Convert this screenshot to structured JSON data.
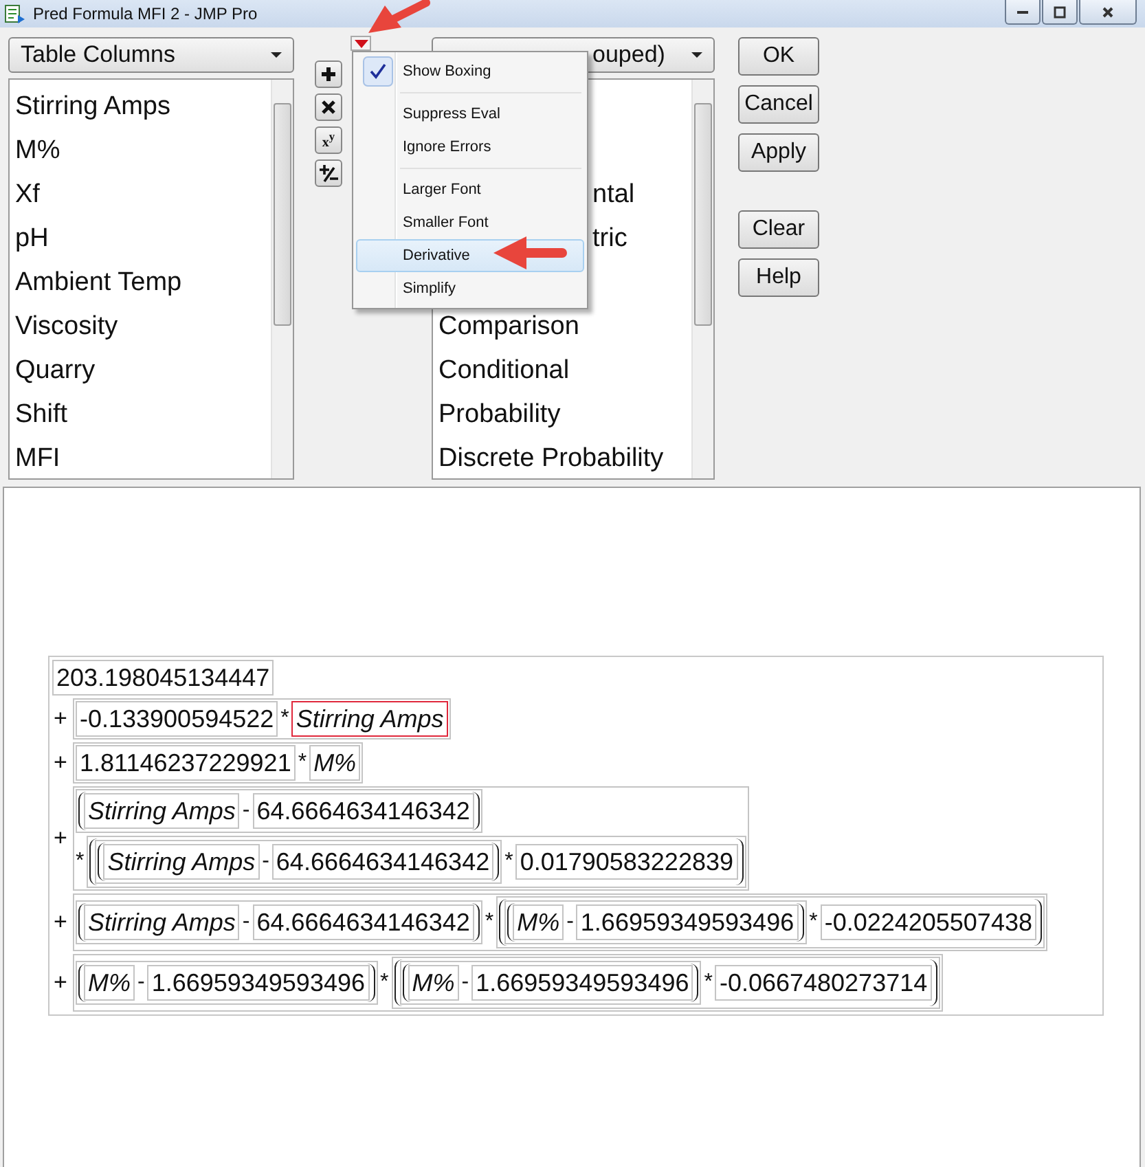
{
  "window": {
    "title": "Pred Formula MFI 2 - JMP Pro"
  },
  "columns_panel": {
    "dropdown": "Table Columns",
    "items": [
      "Stirring Amps",
      "M%",
      "Xf",
      "pH",
      "Ambient Temp",
      "Viscosity",
      "Quarry",
      "Shift",
      "MFI"
    ]
  },
  "keypad": [
    {
      "kind": "plus"
    },
    {
      "kind": "times"
    },
    {
      "kind": "power",
      "label": "x$^{y}$"
    },
    {
      "kind": "plusminus"
    }
  ],
  "options_menu": {
    "items": [
      {
        "kind": "item",
        "label": "Show Boxing",
        "checked": true,
        "selected": false
      },
      {
        "kind": "separator"
      },
      {
        "kind": "item",
        "label": "Suppress Eval",
        "checked": false,
        "selected": false
      },
      {
        "kind": "item",
        "label": "Ignore Errors",
        "checked": false,
        "selected": false
      },
      {
        "kind": "separator"
      },
      {
        "kind": "item",
        "label": "Larger Font",
        "checked": false,
        "selected": false
      },
      {
        "kind": "item",
        "label": "Smaller Font",
        "checked": false,
        "selected": false
      },
      {
        "kind": "item",
        "label": "Derivative",
        "checked": false,
        "selected": true
      },
      {
        "kind": "item",
        "label": "Simplify",
        "checked": false,
        "selected": false
      }
    ]
  },
  "functions_panel": {
    "dropdown": "ouped)",
    "items": [
      {
        "text": "ntal",
        "kind": "cut"
      },
      {
        "text": "tric",
        "kind": "cut"
      },
      {
        "text": "Comparison",
        "kind": "full"
      },
      {
        "text": "Conditional",
        "kind": "full"
      },
      {
        "text": "Probability",
        "kind": "full"
      },
      {
        "text": "Discrete Probability",
        "kind": "full"
      }
    ]
  },
  "buttons": [
    {
      "label": "OK",
      "kind": "push"
    },
    {
      "label": "Cancel",
      "kind": "push"
    },
    {
      "label": "Apply",
      "kind": "push"
    },
    {
      "label": "Clear",
      "kind": "gap"
    },
    {
      "label": "Help",
      "kind": "push"
    }
  ],
  "formula": {
    "terms": [
      {
        "items": [
          {
            "kind": "num",
            "text": "203.198045134447"
          }
        ]
      },
      {
        "sign": "+",
        "items": [
          {
            "kind": "group",
            "items": [
              {
                "kind": "num",
                "text": "-0.133900594522"
              },
              {
                "kind": "op",
                "text": "*"
              },
              {
                "kind": "col",
                "text": "Stirring Amps",
                "selected": true
              }
            ]
          }
        ]
      },
      {
        "sign": "+",
        "items": [
          {
            "kind": "group",
            "items": [
              {
                "kind": "num",
                "text": "1.81146237229921"
              },
              {
                "kind": "op",
                "text": "*"
              },
              {
                "kind": "col",
                "text": "M%",
                "selected": false
              }
            ]
          }
        ]
      },
      {
        "sign": "+",
        "items": [
          {
            "kind": "stack",
            "lines": [
              {
                "items": [
                  {
                    "kind": "paren",
                    "items": [
                      {
                        "kind": "col",
                        "text": "Stirring Amps",
                        "selected": false
                      },
                      {
                        "kind": "op",
                        "text": "-"
                      },
                      {
                        "kind": "num",
                        "text": "64.6664634146342"
                      }
                    ]
                  }
                ]
              },
              {
                "items": [
                  {
                    "kind": "op",
                    "text": "*"
                  },
                  {
                    "kind": "paren",
                    "items": [
                      {
                        "kind": "paren",
                        "items": [
                          {
                            "kind": "col",
                            "text": "Stirring Amps",
                            "selected": false
                          },
                          {
                            "kind": "op",
                            "text": "-"
                          },
                          {
                            "kind": "num",
                            "text": "64.6664634146342"
                          }
                        ]
                      },
                      {
                        "kind": "op",
                        "text": "*"
                      },
                      {
                        "kind": "num",
                        "text": "0.01790583222839"
                      }
                    ]
                  }
                ]
              }
            ]
          }
        ]
      },
      {
        "sign": "+",
        "items": [
          {
            "kind": "group",
            "items": [
              {
                "kind": "paren",
                "items": [
                  {
                    "kind": "col",
                    "text": "Stirring Amps",
                    "selected": false
                  },
                  {
                    "kind": "op",
                    "text": "-"
                  },
                  {
                    "kind": "num",
                    "text": "64.6664634146342"
                  }
                ]
              },
              {
                "kind": "op",
                "text": "*"
              },
              {
                "kind": "paren",
                "items": [
                  {
                    "kind": "paren",
                    "items": [
                      {
                        "kind": "col",
                        "text": "M%",
                        "selected": false
                      },
                      {
                        "kind": "op",
                        "text": "-"
                      },
                      {
                        "kind": "num",
                        "text": "1.66959349593496"
                      }
                    ]
                  },
                  {
                    "kind": "op",
                    "text": "*"
                  },
                  {
                    "kind": "num",
                    "text": "-0.0224205507438"
                  }
                ]
              }
            ]
          }
        ]
      },
      {
        "sign": "+",
        "items": [
          {
            "kind": "group",
            "items": [
              {
                "kind": "paren",
                "items": [
                  {
                    "kind": "col",
                    "text": "M%",
                    "selected": false
                  },
                  {
                    "kind": "op",
                    "text": "-"
                  },
                  {
                    "kind": "num",
                    "text": "1.66959349593496"
                  }
                ]
              },
              {
                "kind": "op",
                "text": "*"
              },
              {
                "kind": "paren",
                "items": [
                  {
                    "kind": "paren",
                    "items": [
                      {
                        "kind": "col",
                        "text": "M%",
                        "selected": false
                      },
                      {
                        "kind": "op",
                        "text": "-"
                      },
                      {
                        "kind": "num",
                        "text": "1.66959349593496"
                      }
                    ]
                  },
                  {
                    "kind": "op",
                    "text": "*"
                  },
                  {
                    "kind": "num",
                    "text": "-0.0667480273714"
                  }
                ]
              }
            ]
          }
        ]
      }
    ]
  }
}
